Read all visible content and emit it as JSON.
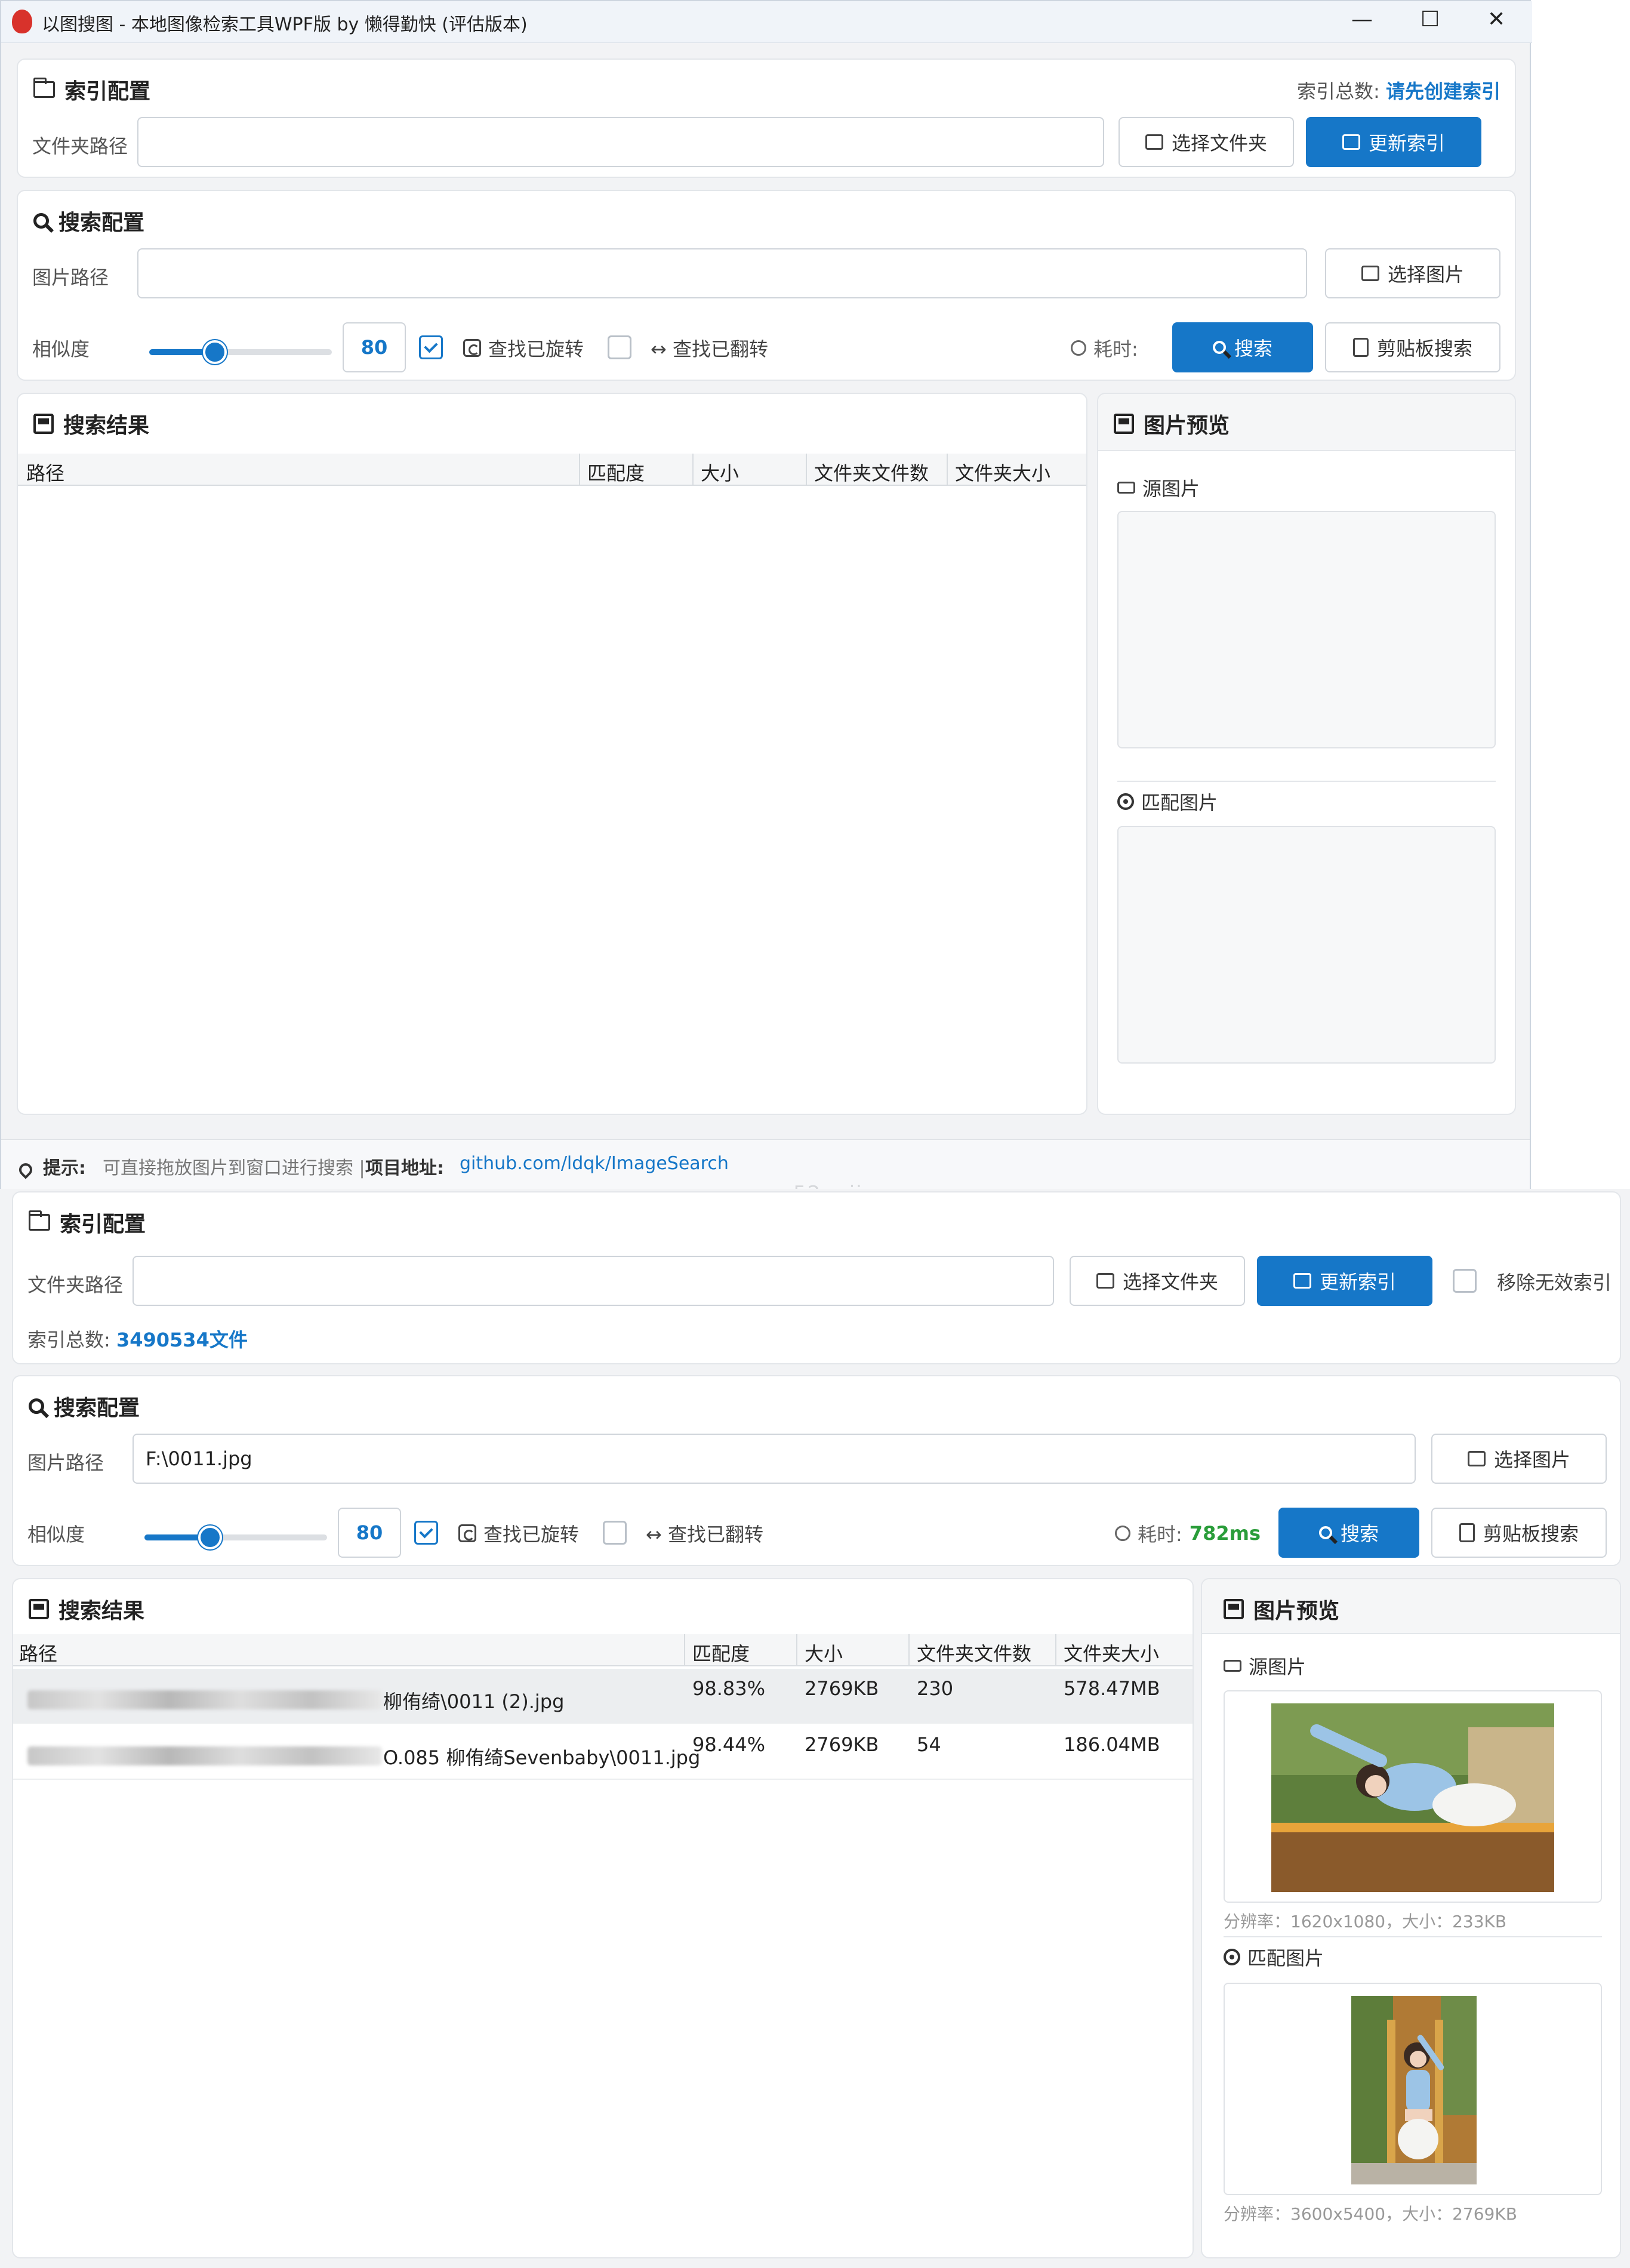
{
  "window1": {
    "title": "以图搜图 - 本地图像检索工具WPF版 by 懒得勤快 (评估版本)",
    "controls": {
      "minimize": "—",
      "maximize": "☐",
      "close": "✕"
    },
    "index_config": {
      "title": "索引配置",
      "count_label": "索引总数:",
      "count_value": "请先创建索引",
      "folder_label": "文件夹路径",
      "folder_value": "",
      "select_folder": "选择文件夹",
      "update_index": "更新索引"
    },
    "search_config": {
      "title": "搜索配置",
      "image_label": "图片路径",
      "image_value": "",
      "select_image": "选择图片",
      "similarity_label": "相似度",
      "similarity_value": "80",
      "similarity": 80,
      "find_rotated": "查找已旋转",
      "find_rotated_checked": true,
      "find_flipped": "↔ 查找已翻转",
      "find_flipped_checked": false,
      "elapsed_label": "耗时:",
      "elapsed_value": "",
      "search": "搜索",
      "clipboard_search": "剪贴板搜索"
    },
    "results": {
      "title": "搜索结果",
      "columns": [
        "路径",
        "匹配度",
        "大小",
        "文件夹文件数",
        "文件夹大小"
      ],
      "rows": []
    },
    "preview": {
      "title": "图片预览",
      "source_label": "源图片",
      "match_label": "匹配图片"
    },
    "status": {
      "hint_label": "提示:",
      "hint_text": "可直接拖放图片到窗口进行搜索 |",
      "project_label": "项目地址:",
      "project_link": "github.com/ldqk/ImageSearch"
    }
  },
  "watermark": "www.52pojie.cn",
  "window2": {
    "index_config": {
      "title": "索引配置",
      "folder_label": "文件夹路径",
      "folder_value": "",
      "select_folder": "选择文件夹",
      "update_index": "更新索引",
      "remove_invalid": "移除无效索引",
      "remove_invalid_checked": false,
      "count_label": "索引总数:",
      "count_value": "3490534文件"
    },
    "search_config": {
      "title": "搜索配置",
      "image_label": "图片路径",
      "image_value": "F:\\0011.jpg",
      "select_image": "选择图片",
      "similarity_label": "相似度",
      "similarity_value": "80",
      "similarity": 80,
      "find_rotated": "查找已旋转",
      "find_rotated_checked": true,
      "find_flipped": "↔ 查找已翻转",
      "find_flipped_checked": false,
      "elapsed_label": "耗时:",
      "elapsed_value": "782ms",
      "search": "搜索",
      "clipboard_search": "剪贴板搜索"
    },
    "results": {
      "title": "搜索结果",
      "columns": [
        "路径",
        "匹配度",
        "大小",
        "文件夹文件数",
        "文件夹大小"
      ],
      "rows": [
        {
          "path": "柳侑绮\\0011 (2).jpg",
          "match": "98.83%",
          "size": "2769KB",
          "folder_files": "230",
          "folder_size": "578.47MB"
        },
        {
          "path": "O.085 柳侑绮Sevenbaby\\0011.jpg",
          "match": "98.44%",
          "size": "2769KB",
          "folder_files": "54",
          "folder_size": "186.04MB"
        }
      ]
    },
    "preview": {
      "title": "图片预览",
      "source_label": "源图片",
      "source_info": "分辨率：1620x1080，大小：233KB",
      "match_label": "匹配图片",
      "match_info": "分辨率：3600x5400，大小：2769KB"
    }
  },
  "colors": {
    "accent": "#1677c8",
    "success": "#2a9d3a",
    "link": "#1677c8"
  }
}
